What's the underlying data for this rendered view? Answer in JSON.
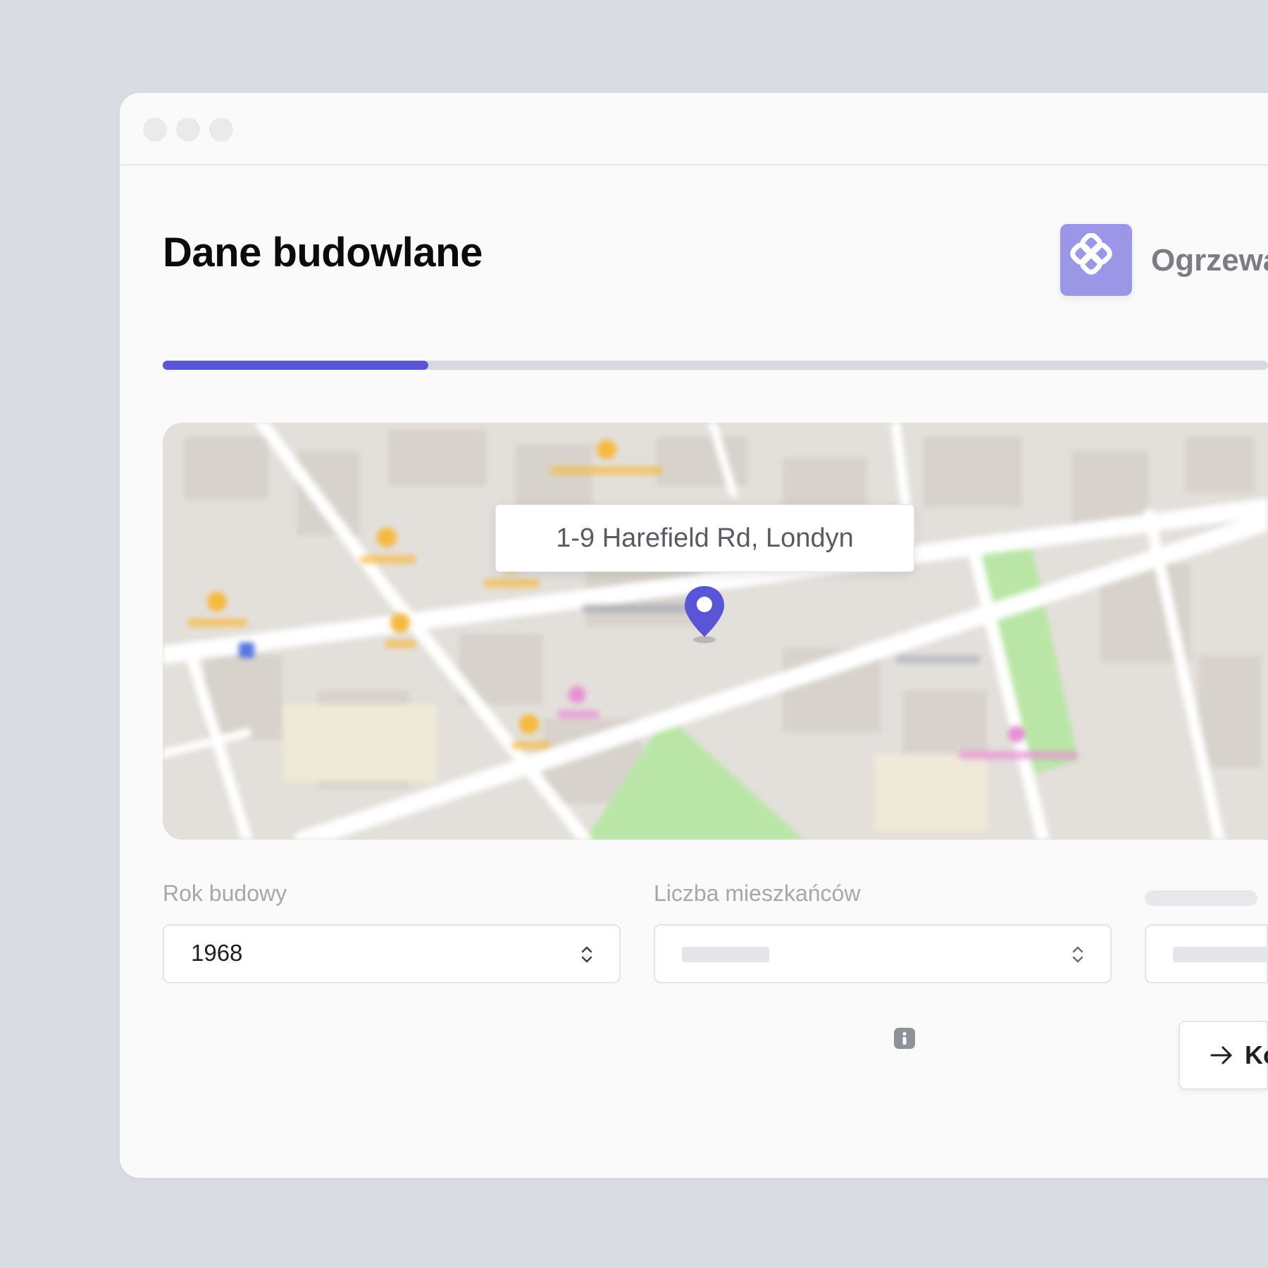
{
  "header": {
    "title": "Dane budowlane",
    "brand_name": "Ogrzewa"
  },
  "progress": {
    "fraction": 0.24
  },
  "map": {
    "address": "1-9 Harefield Rd, Londyn"
  },
  "form": {
    "year_label": "Rok budowy",
    "year_value": "1968",
    "residents_label": "Liczba mieszkańców"
  },
  "actions": {
    "next_label": "Ko"
  },
  "colors": {
    "accent": "#5a55d6",
    "brand_logo_bg": "#9b96e6",
    "park_green": "#b9e6a6"
  },
  "icons": {
    "brand": "brand-logo-icon",
    "pin": "map-pin-icon",
    "stepper": "chevron-up-down-icon",
    "info": "info-icon",
    "next": "arrow-right-icon"
  }
}
